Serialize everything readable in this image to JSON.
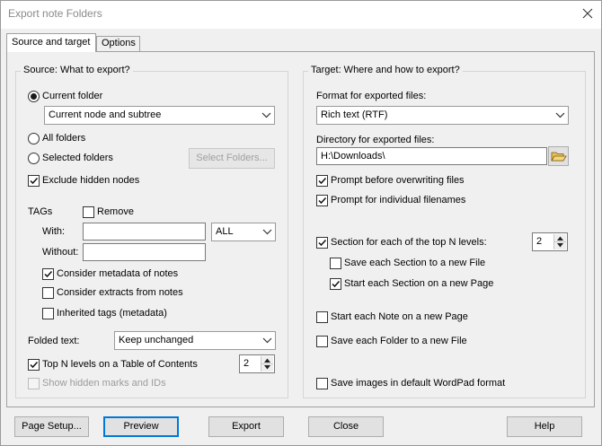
{
  "window": {
    "title": "Export note Folders"
  },
  "tabs": [
    {
      "label": "Source and target",
      "active": true
    },
    {
      "label": "Options",
      "active": false
    }
  ],
  "source": {
    "group_title": "Source: What to export?",
    "current_folder": {
      "label": "Current folder",
      "selected": true
    },
    "scope_combo": {
      "value": "Current node and subtree"
    },
    "all_folders": {
      "label": "All folders",
      "selected": false
    },
    "selected_folders": {
      "label": "Selected folders",
      "selected": false
    },
    "select_folders_button": "Select Folders...",
    "exclude_hidden": {
      "label": "Exclude hidden nodes",
      "checked": true
    },
    "tags": {
      "title": "TAGs",
      "remove": {
        "label": "Remove",
        "checked": false
      },
      "with_label": "With:",
      "with_value": "",
      "with_mode": "ALL",
      "without_label": "Without:",
      "without_value": "",
      "consider_metadata": {
        "label": "Consider metadata of notes",
        "checked": true
      },
      "consider_extracts": {
        "label": "Consider extracts from notes",
        "checked": false
      },
      "inherited_tags": {
        "label": "Inherited tags (metadata)",
        "checked": false
      }
    },
    "folded_text": {
      "label": "Folded text:",
      "value": "Keep unchanged"
    },
    "top_n_toc": {
      "label": "Top N levels on a Table of Contents",
      "checked": true,
      "value": "2"
    },
    "show_hidden_marks": {
      "label": "Show hidden marks and IDs",
      "checked": false,
      "disabled": true
    }
  },
  "target": {
    "group_title": "Target: Where and how to export?",
    "format_label": "Format for exported files:",
    "format_value": "Rich text (RTF)",
    "directory_label": "Directory for exported files:",
    "directory_value": "H:\\Downloads\\",
    "prompt_overwrite": {
      "label": "Prompt before overwriting files",
      "checked": true
    },
    "prompt_filenames": {
      "label": "Prompt for individual filenames",
      "checked": true
    },
    "section_top_n": {
      "label": "Section for each of the top N levels:",
      "checked": true,
      "value": "2"
    },
    "save_section_file": {
      "label": "Save each Section to a new File",
      "checked": false
    },
    "start_section_page": {
      "label": "Start each Section on a new Page",
      "checked": true
    },
    "note_new_page": {
      "label": "Start each Note on a new Page",
      "checked": false
    },
    "folder_new_file": {
      "label": "Save each Folder to a new File",
      "checked": false
    },
    "save_images_wordpad": {
      "label": "Save images in default WordPad format",
      "checked": false
    }
  },
  "buttons": {
    "page_setup": "Page Setup...",
    "preview": "Preview",
    "export": "Export",
    "close": "Close",
    "help": "Help"
  }
}
